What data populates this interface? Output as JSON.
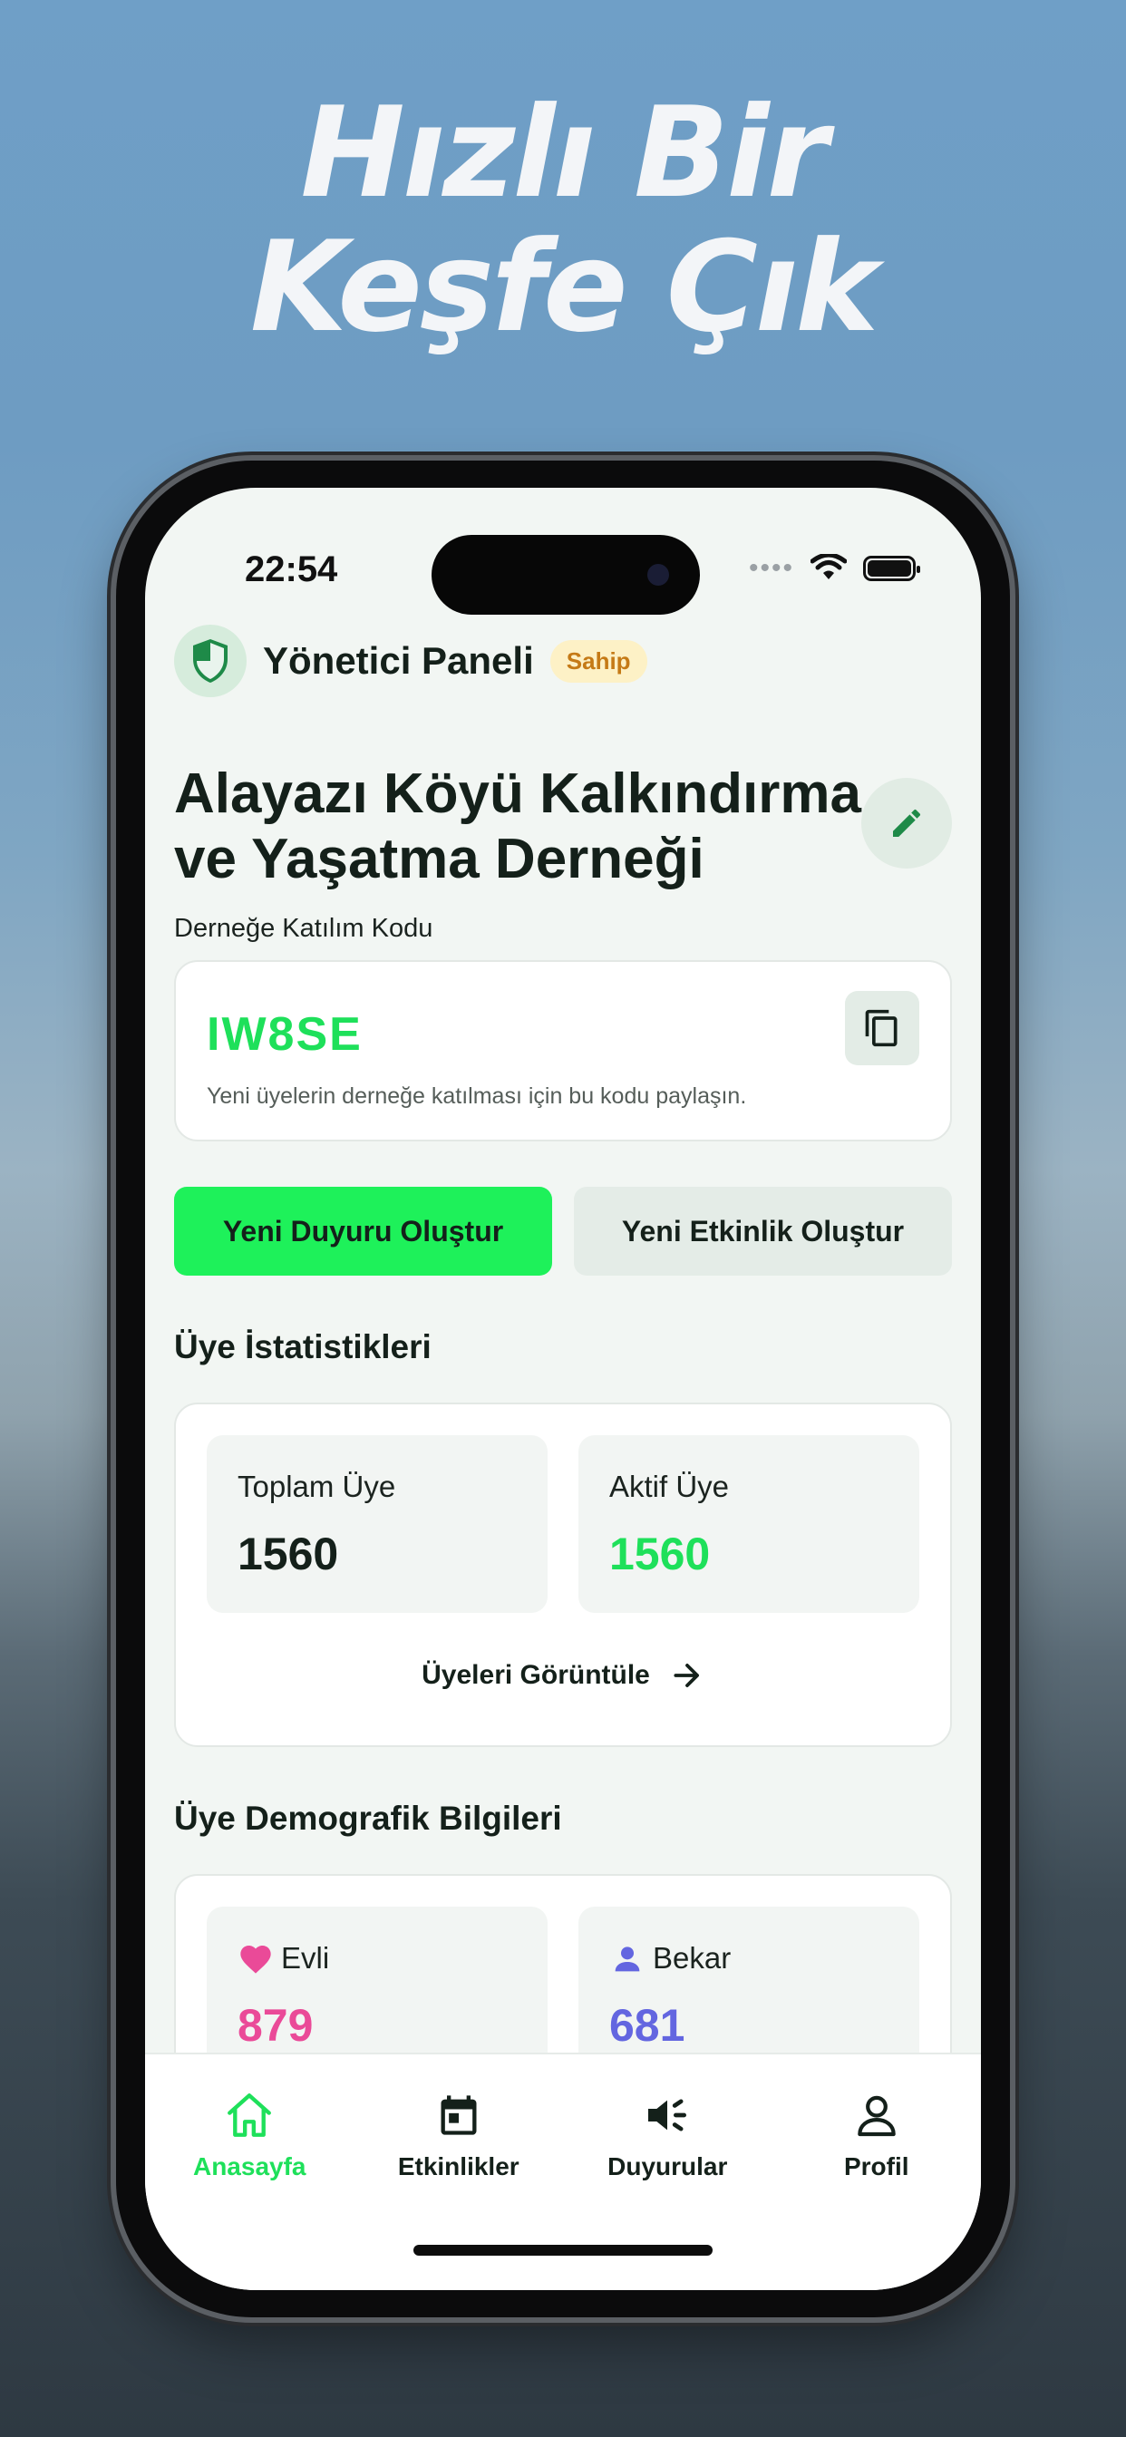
{
  "promo": {
    "line1": "Hızlı Bir",
    "line2": "Keşfe Çık"
  },
  "status_bar": {
    "time": "22:54",
    "signal_icon": "signal-dots-icon",
    "wifi_icon": "wifi-icon",
    "battery_icon": "battery-icon"
  },
  "header": {
    "title": "Yönetici Paneli",
    "role_badge": "Sahip",
    "icon": "shield-icon"
  },
  "association": {
    "name": "Alayazı Köyü Kalkındırma ve Yaşatma Derneği",
    "edit_icon": "pencil-icon",
    "join_code_label": "Derneğe Katılım Kodu",
    "join_code": "IW8SE",
    "join_code_hint": "Yeni üyelerin derneğe katılması için bu kodu paylaşın.",
    "copy_icon": "copy-icon"
  },
  "actions": {
    "new_announcement": "Yeni Duyuru Oluştur",
    "new_event": "Yeni Etkinlik Oluştur"
  },
  "member_stats": {
    "title": "Üye İstatistikleri",
    "total_label": "Toplam Üye",
    "total_value": "1560",
    "active_label": "Aktif Üye",
    "active_value": "1560",
    "view_members": "Üyeleri Görüntüle"
  },
  "demographics": {
    "title": "Üye Demografik Bilgileri",
    "married_label": "Evli",
    "married_value": "879",
    "single_label": "Bekar",
    "single_value": "681"
  },
  "tabbar": {
    "home": "Anasayfa",
    "events": "Etkinlikler",
    "announcements": "Duyurular",
    "profile": "Profil",
    "active_tab": "Anasayfa"
  },
  "colors": {
    "accent": "#1EE05A",
    "pink": "#EA4A98",
    "indigo": "#6366E0",
    "badge_bg": "#FDF1C6",
    "badge_text": "#C57A16"
  }
}
